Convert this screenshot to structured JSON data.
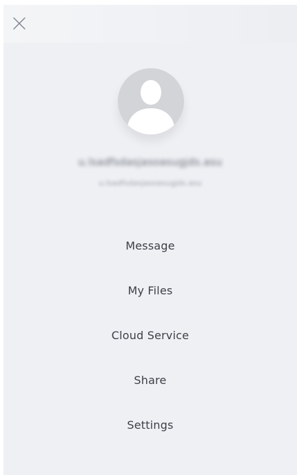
{
  "header": {
    "close_icon": "close-icon"
  },
  "profile": {
    "avatar_icon": "person-icon",
    "name": "u.lsadfsdasjasoasugjds.asu",
    "email": "u.lsadfsdasjasoasugjds.asu"
  },
  "menu": {
    "items": [
      {
        "label": "Message"
      },
      {
        "label": "My Files"
      },
      {
        "label": "Cloud Service"
      },
      {
        "label": "Share"
      },
      {
        "label": "Settings"
      }
    ]
  },
  "colors": {
    "panel_background": "#eff0f4",
    "text": "#3b3f45",
    "avatar": "#d4d5d8"
  }
}
